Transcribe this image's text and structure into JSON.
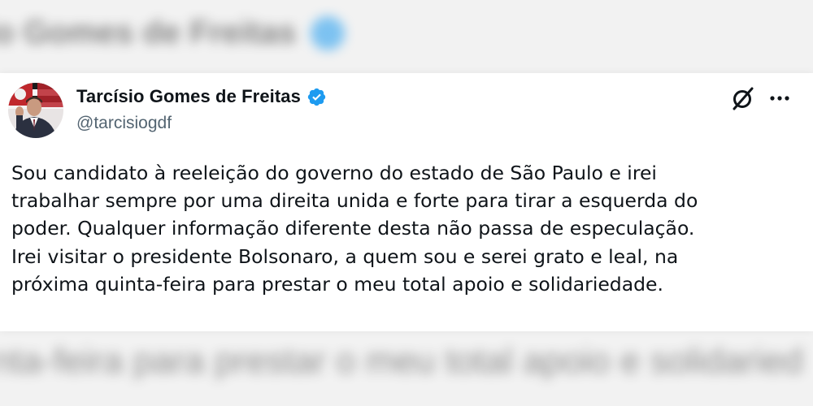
{
  "background": {
    "top_blurred_text": "io Gomes de Freitas",
    "bottom_blurred_text": "nta-feira para prestar o meu total apoio e solidaried"
  },
  "tweet": {
    "author": {
      "display_name": "Tarcísio Gomes de Freitas",
      "handle": "@tarcisiogdf",
      "verified": true,
      "avatar_icon": "avatar-portrait-with-sao-paulo-flag"
    },
    "actions": {
      "grok_icon": "slash-circle-icon",
      "more_icon": "more-options-icon"
    },
    "text_lines": [
      "Sou candidato à reeleição do governo do estado de São Paulo e irei",
      "trabalhar sempre por uma direita unida e forte para tirar a esquerda do",
      "poder. Qualquer informação diferente desta não passa de especulação.",
      "Irei visitar o presidente Bolsonaro, a quem sou e serei grato e leal, na",
      "próxima quinta-feira para prestar o meu total apoio e solidariedade."
    ]
  },
  "colors": {
    "verified_blue": "#1d9bf0",
    "text_primary": "#0f1419",
    "text_secondary": "#536471",
    "card_background": "#ffffff"
  }
}
